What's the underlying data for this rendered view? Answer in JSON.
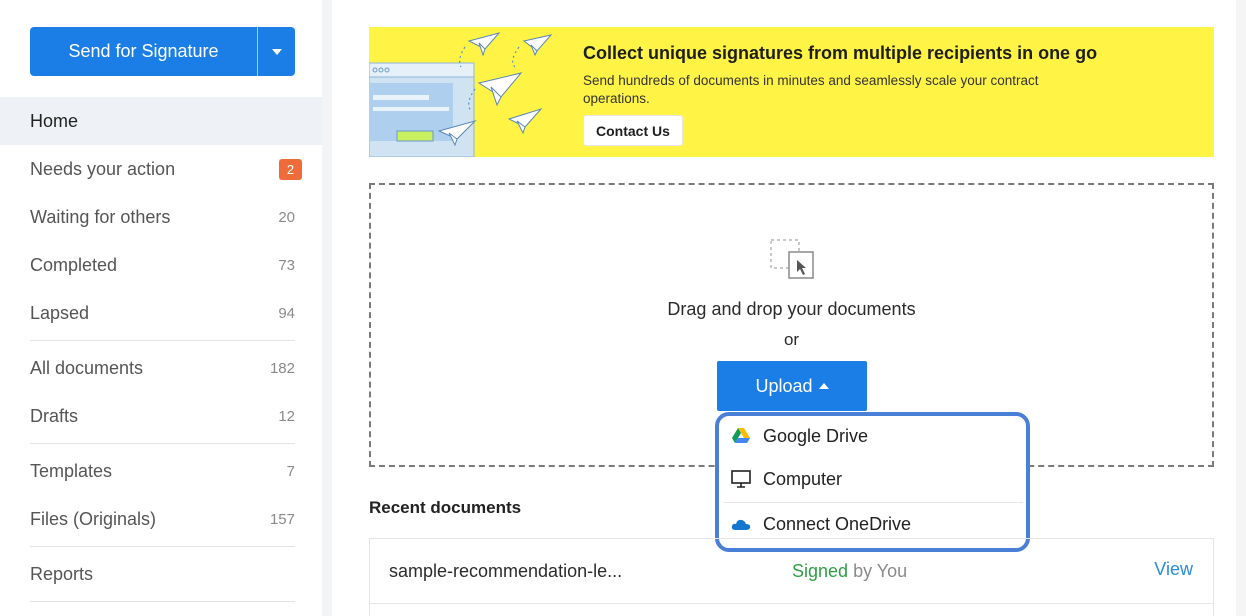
{
  "sidebar": {
    "send_button_label": "Send for Signature",
    "items": [
      {
        "label": "Home",
        "count": ""
      },
      {
        "label": "Needs your action",
        "count": "2"
      },
      {
        "label": "Waiting for others",
        "count": "20"
      },
      {
        "label": "Completed",
        "count": "73"
      },
      {
        "label": "Lapsed",
        "count": "94"
      },
      {
        "label": "All documents",
        "count": "182"
      },
      {
        "label": "Drafts",
        "count": "12"
      },
      {
        "label": "Templates",
        "count": "7"
      },
      {
        "label": "Files (Originals)",
        "count": "157"
      },
      {
        "label": "Reports",
        "count": ""
      }
    ]
  },
  "banner": {
    "title": "Collect unique signatures from multiple recipients in one go",
    "subtitle": "Send hundreds of documents in minutes and seamlessly scale your contract operations.",
    "cta_label": "Contact Us"
  },
  "dropzone": {
    "text": "Drag and drop your documents",
    "or": "or",
    "upload_label": "Upload"
  },
  "upload_menu": {
    "items": [
      {
        "label": "Google Drive",
        "icon": "google-drive-icon"
      },
      {
        "label": "Computer",
        "icon": "computer-icon"
      },
      {
        "label": "Connect OneDrive",
        "icon": "onedrive-icon"
      }
    ]
  },
  "recent": {
    "title": "Recent documents",
    "documents": [
      {
        "name": "sample-recommendation-le...",
        "status_signed": "Signed",
        "status_by": "by You",
        "action": "View"
      }
    ]
  },
  "colors": {
    "primary": "#1a7ee6",
    "banner_bg": "#fff445",
    "badge": "#ef6b3a",
    "signed": "#2f9e44",
    "menu_outline": "#4a7fd8"
  }
}
